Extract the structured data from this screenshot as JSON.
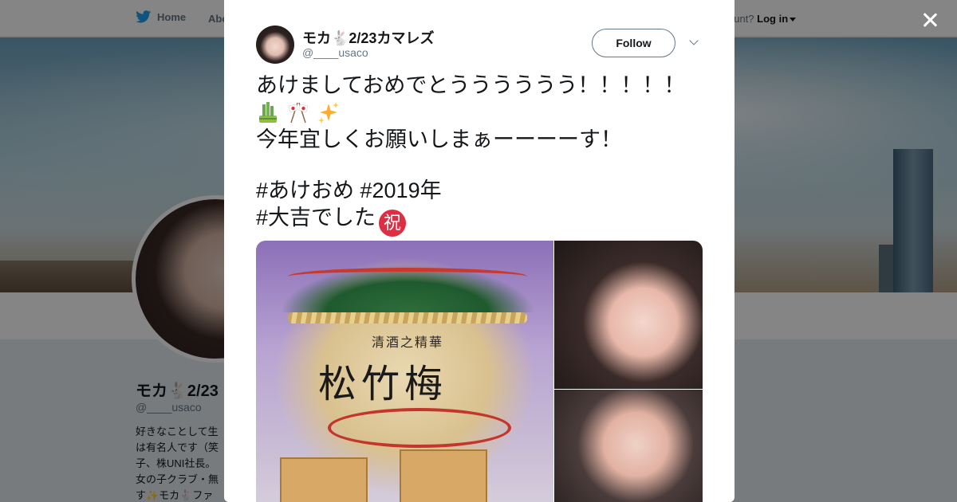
{
  "background_page": {
    "nav": {
      "home_label": "Home",
      "about_label": "Abo",
      "login_prefix": "ccount?",
      "login_label": "Log in"
    },
    "profile": {
      "name": "モカ🐇2/23",
      "handle": "@____usaco",
      "bio": "好きなことして生\nは有名人です（笑\n子、株UNI社長。\n女の子クラブ・無\nす✨モカ🐇ファ"
    }
  },
  "tweet": {
    "author_name": "モカ🐇2/23カマレズ",
    "author_handle": "@____usaco",
    "follow_label": "Follow",
    "text_line1": "あけましておめでとうううううう！！！！！",
    "emoji_row": [
      "🎍",
      "🎌",
      "✨"
    ],
    "text_line2": "今年宜しくお願いしまぁーーーーす！",
    "hashtags_line1": "#あけおめ #2019年",
    "hashtags_line2": "#大吉でした",
    "shuku_glyph": "祝",
    "media_image_text": {
      "barrel_sub": "清酒之精華",
      "barrel_label": "松竹梅"
    }
  },
  "icons": {
    "close": "close-icon",
    "twitter_bird": "twitter-bird-icon",
    "caret": "chevron-down-icon"
  },
  "colors": {
    "twitter_blue": "#1da1f2",
    "text_primary": "#14171a",
    "text_secondary": "#657786",
    "overlay": "rgba(0,0,0,0.48)"
  }
}
